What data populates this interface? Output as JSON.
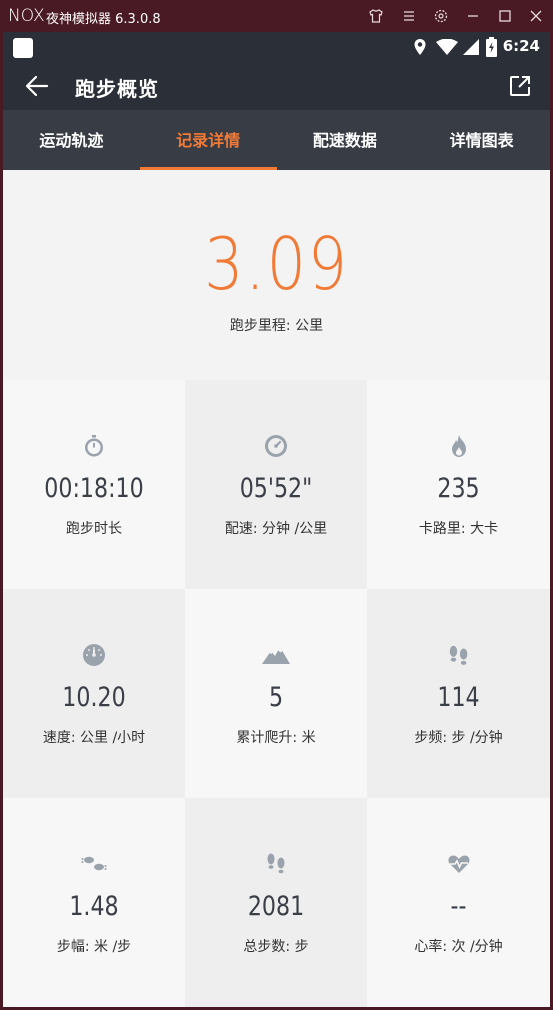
{
  "window": {
    "logo": "NOX",
    "title": "夜神模拟器 6.3.0.8"
  },
  "statusbar": {
    "time": "6:24"
  },
  "header": {
    "title": "跑步概览"
  },
  "tabs": [
    {
      "label": "运动轨迹"
    },
    {
      "label": "记录详情"
    },
    {
      "label": "配速数据"
    },
    {
      "label": "详情图表"
    }
  ],
  "summary": {
    "value": "3.09",
    "label": "跑步里程: 公里"
  },
  "stats": [
    {
      "icon": "stopwatch-icon",
      "value": "00:18:10",
      "label": "跑步时长"
    },
    {
      "icon": "pace-dial-icon",
      "value": "05'52\"",
      "label": "配速: 分钟 /公里"
    },
    {
      "icon": "flame-icon",
      "value": "235",
      "label": "卡路里: 大卡"
    },
    {
      "icon": "speedometer-icon",
      "value": "10.20",
      "label": "速度: 公里 /小时"
    },
    {
      "icon": "mountain-icon",
      "value": "5",
      "label": "累计爬升: 米"
    },
    {
      "icon": "footprints-icon",
      "value": "114",
      "label": "步频: 步 /分钟"
    },
    {
      "icon": "stride-icon",
      "value": "1.48",
      "label": "步幅: 米 /步"
    },
    {
      "icon": "steps-icon",
      "value": "2081",
      "label": "总步数: 步"
    },
    {
      "icon": "heart-rate-icon",
      "value": "--",
      "label": "心率: 次 /分钟"
    }
  ],
  "colors": {
    "accent": "#f07a36",
    "header_bg": "#2b2f37",
    "tabs_bg": "#383c45",
    "icon": "#9aa2ac",
    "value_text": "#3a3f47"
  }
}
